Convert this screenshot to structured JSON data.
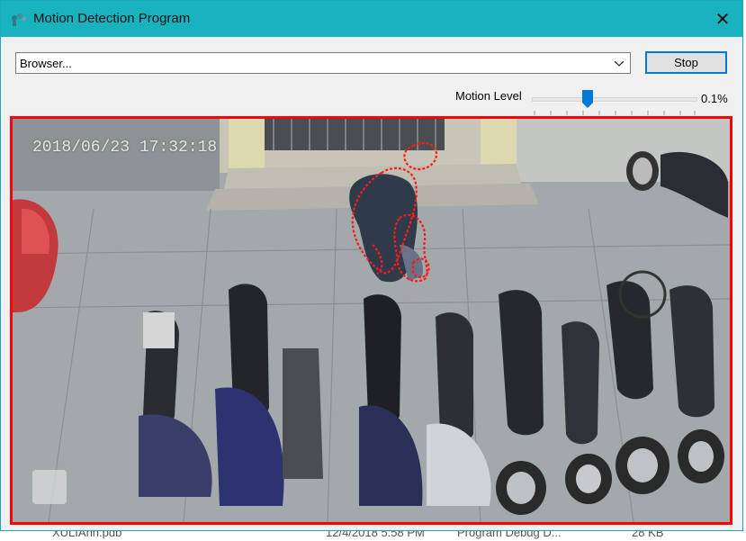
{
  "window": {
    "title": "Motion Detection Program",
    "close_glyph": "✕",
    "accent_color": "#19b3c0"
  },
  "source_select": {
    "value": "Browser...",
    "icon": "chevron-down-icon"
  },
  "stop_button": {
    "label": "Stop"
  },
  "motion_level": {
    "label": "Motion Level",
    "value_text": "0.1%",
    "slider_fraction": 0.33
  },
  "video": {
    "timestamp": "2018/06/23 17:32:18",
    "highlight_color": "#ff0000"
  },
  "background_explorer_row": {
    "name": "XULIAnh.pdb",
    "date": "12/4/2018 5:58 PM",
    "type": "Program Debug D...",
    "size": "28 KB"
  }
}
